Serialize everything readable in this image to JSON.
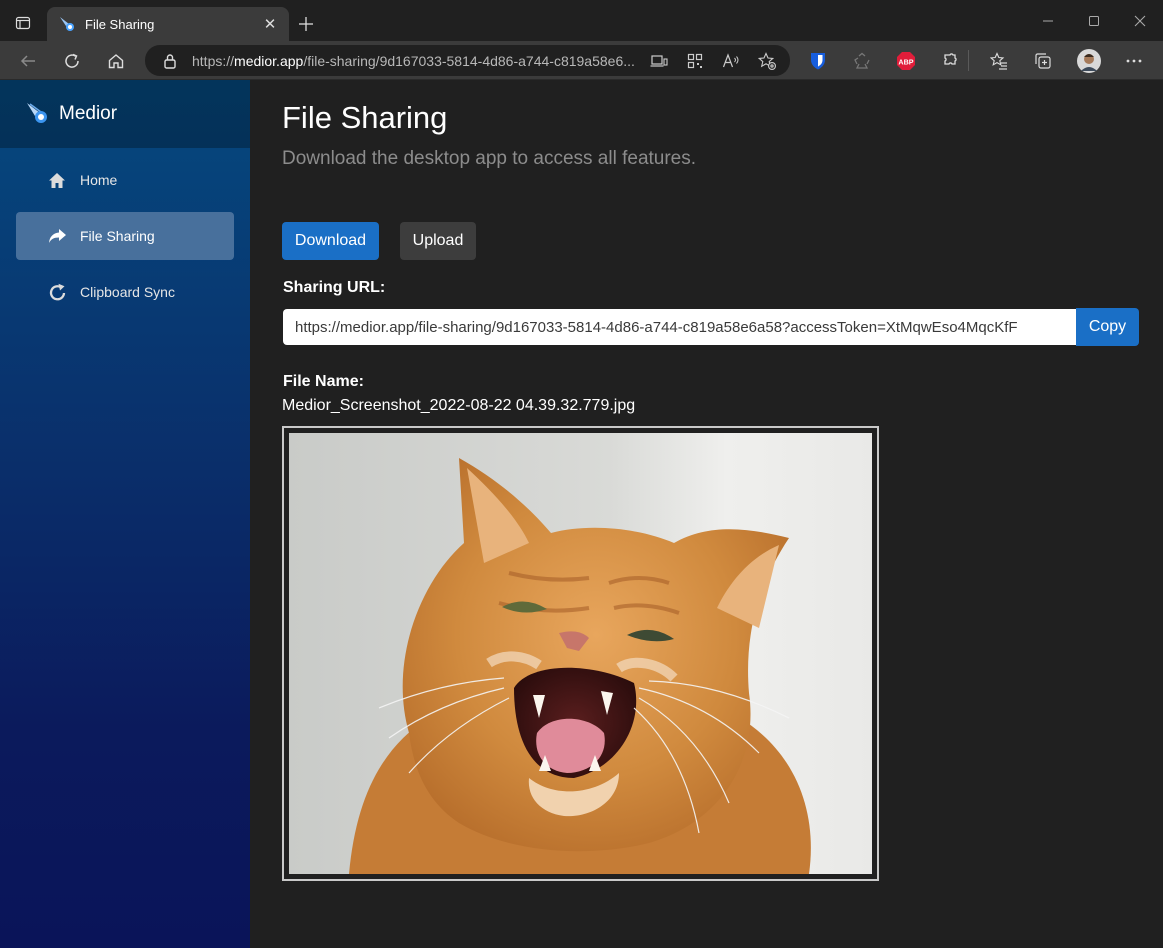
{
  "browser": {
    "tab_title": "File Sharing",
    "url_prefix": "https://",
    "url_host": "medior.app",
    "url_path": "/file-sharing/9d167033-5814-4d86-a744-c819a58e6..."
  },
  "sidebar": {
    "brand": "Medior",
    "items": [
      {
        "label": "Home",
        "icon": "home-icon",
        "active": false
      },
      {
        "label": "File Sharing",
        "icon": "share-arrow-icon",
        "active": true
      },
      {
        "label": "Clipboard Sync",
        "icon": "refresh-icon",
        "active": false
      }
    ]
  },
  "main": {
    "title": "File Sharing",
    "subtitle": "Download the desktop app to access all features.",
    "download_label": "Download",
    "upload_label": "Upload",
    "sharing_url_label": "Sharing URL:",
    "sharing_url_value": "https://medior.app/file-sharing/9d167033-5814-4d86-a744-c819a58e6a58?accessToken=XtMqwEso4MqcKfF",
    "copy_label": "Copy",
    "file_name_label": "File Name:",
    "file_name_value": "Medior_Screenshot_2022-08-22 04.39.32.779.jpg"
  },
  "colors": {
    "accent": "#1a6fc6",
    "sidebar_active": "#48709c",
    "background": "#202020"
  }
}
